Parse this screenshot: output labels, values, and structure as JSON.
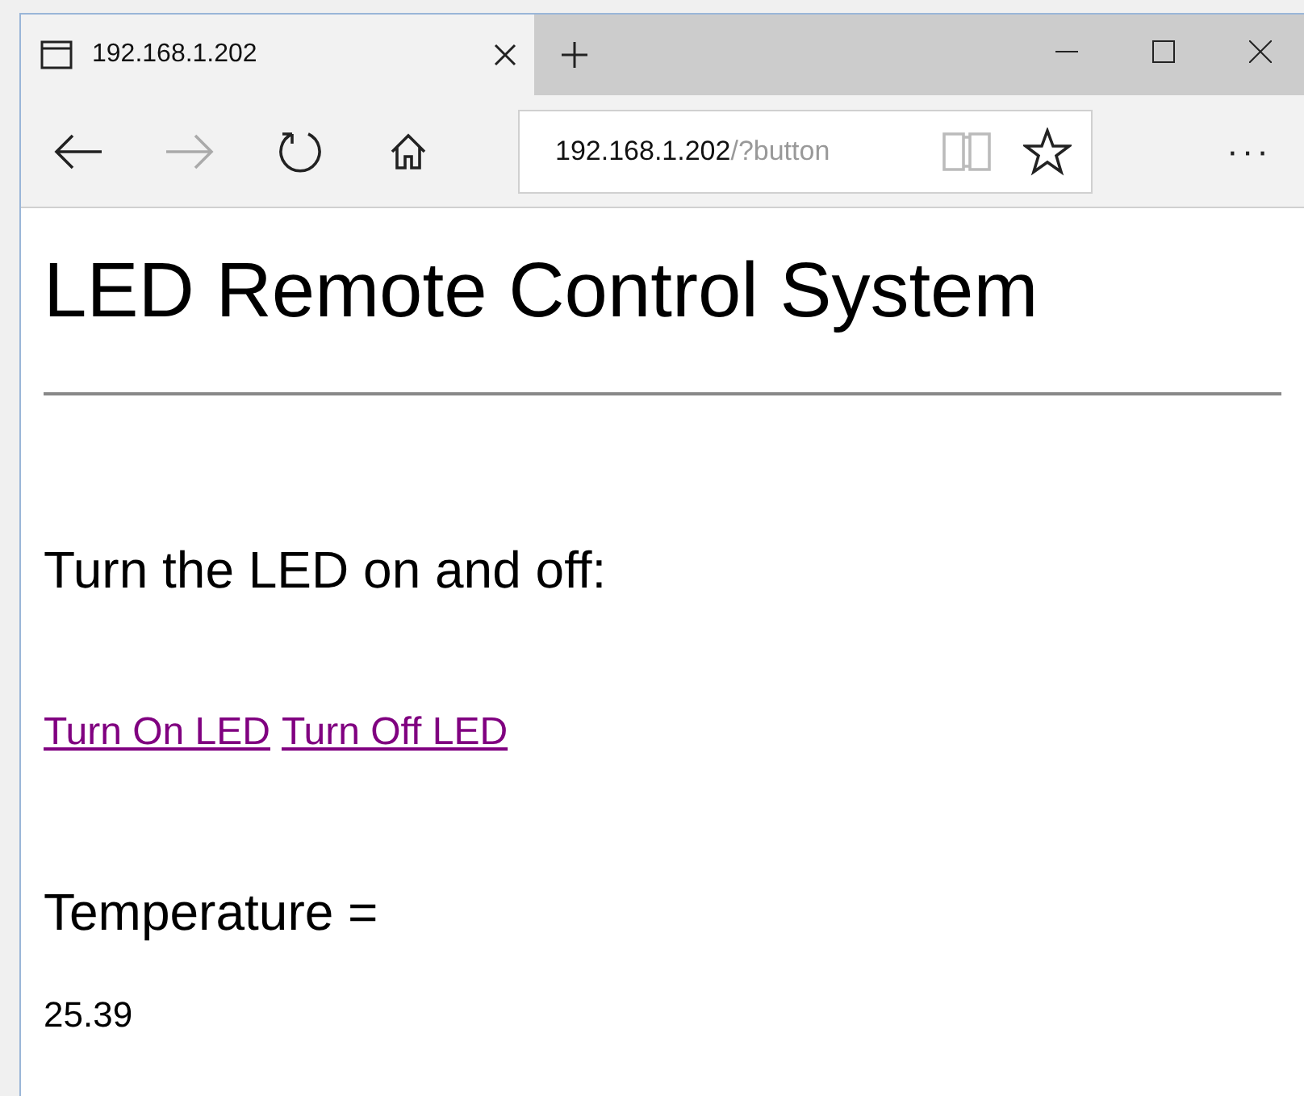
{
  "tab": {
    "title": "192.168.1.202"
  },
  "nav": {
    "back_disabled": false,
    "forward_disabled": true
  },
  "address": {
    "host": "192.168.1.202",
    "path": "/?button"
  },
  "menu_glyph": "···",
  "page": {
    "title": "LED Remote Control System",
    "subtitle": "Turn the LED on and off:",
    "links": [
      {
        "label": "Turn On LED",
        "visited": true
      },
      {
        "label": "Turn Off LED",
        "visited": true
      }
    ],
    "temperature_heading": "Temperature =",
    "temperature": "25.39"
  }
}
